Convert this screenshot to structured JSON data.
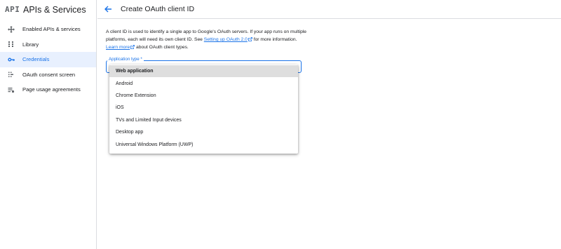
{
  "sidebar": {
    "logo": "API",
    "title": "APIs & Services",
    "items": [
      {
        "label": "Enabled APIs & services",
        "icon": "move-icon"
      },
      {
        "label": "Library",
        "icon": "library-grid-icon"
      },
      {
        "label": "Credentials",
        "icon": "key-icon",
        "active": true
      },
      {
        "label": "OAuth consent screen",
        "icon": "consent-dots-icon"
      },
      {
        "label": "Page usage agreements",
        "icon": "settings-list-icon"
      }
    ]
  },
  "header": {
    "title": "Create OAuth client ID"
  },
  "description": {
    "part1": "A client ID is used to identify a single app to Google's OAuth servers. If your app runs on multiple platforms, each will need its own client ID. See ",
    "link1": "Setting up OAuth 2.0",
    "part2": " for more information. ",
    "link2": "Learn more",
    "part3": " about OAuth client types."
  },
  "form": {
    "application_type_label": "Application type *",
    "options": [
      {
        "label": "Web application",
        "selected": true
      },
      {
        "label": "Android"
      },
      {
        "label": "Chrome Extension"
      },
      {
        "label": "iOS"
      },
      {
        "label": "TVs and Limited Input devices"
      },
      {
        "label": "Desktop app"
      },
      {
        "label": "Universal Windows Platform (UWP)"
      }
    ]
  },
  "colors": {
    "accent": "#1a73e8",
    "active_bg": "#e8f0fe",
    "selected_option_bg": "#dedede"
  }
}
